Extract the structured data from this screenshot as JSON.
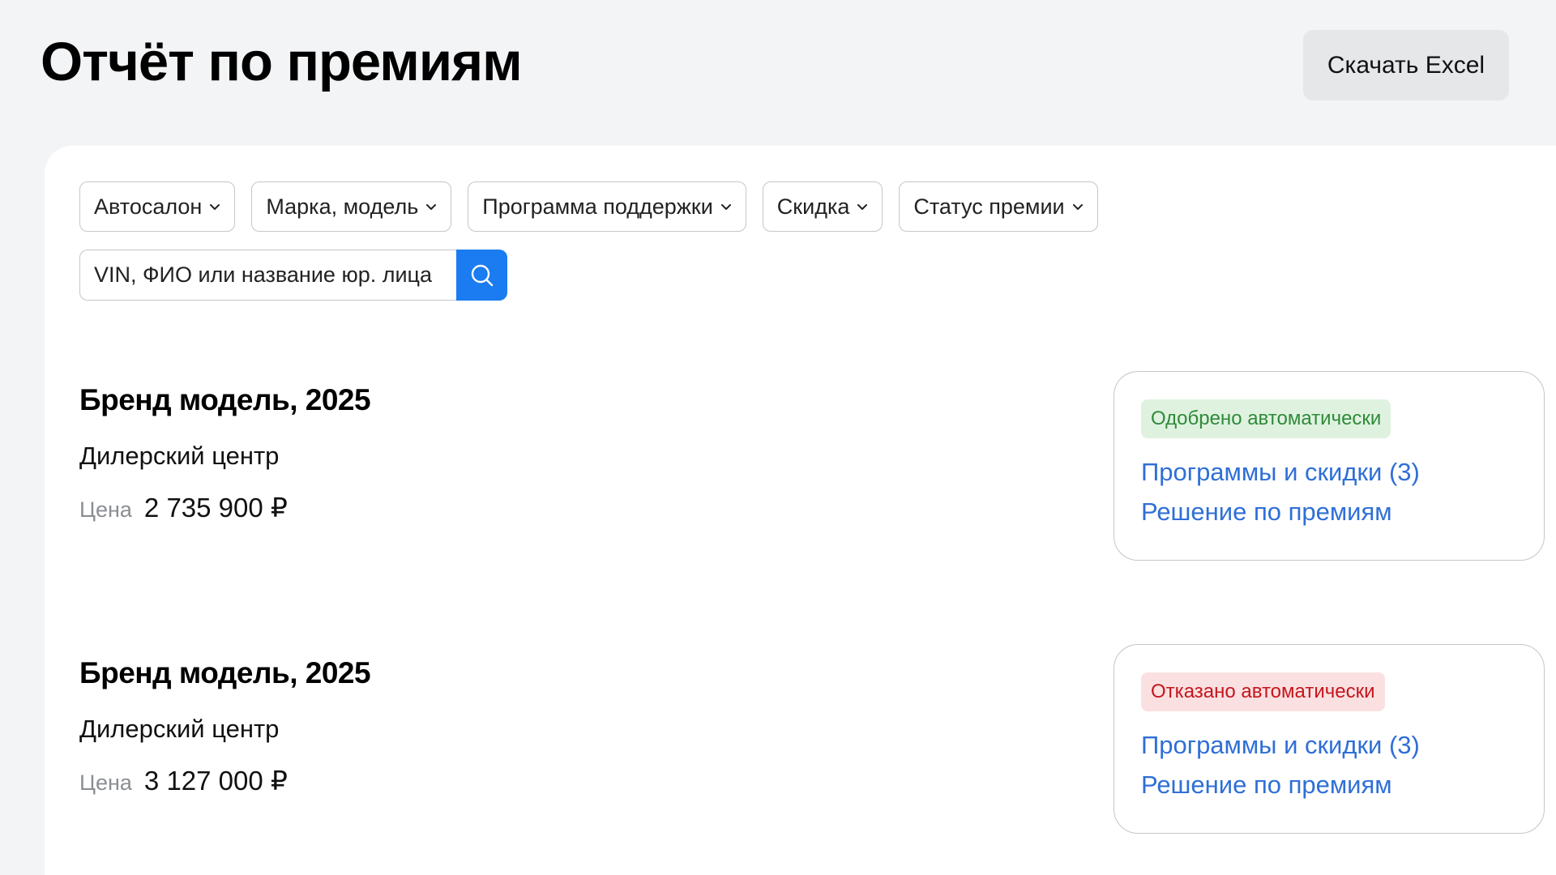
{
  "header": {
    "title": "Отчёт по  премиям",
    "download_label": "Скачать Excel"
  },
  "filters": [
    {
      "label": "Автосалон"
    },
    {
      "label": "Марка, модель"
    },
    {
      "label": "Программа поддержки"
    },
    {
      "label": "Скидка"
    },
    {
      "label": "Статус премии"
    }
  ],
  "search": {
    "placeholder": "VIN, ФИО или название юр. лица",
    "icon": "search-icon"
  },
  "records": [
    {
      "title": "Бренд модель, 2025",
      "dealer": "Дилерский центр",
      "price_label": "Цена",
      "price": "2 735 900 ₽",
      "status": "Одобрено автоматически",
      "status_type": "approved",
      "programs_link": "Программы и скидки (3)",
      "decision_link": "Решение по премиям"
    },
    {
      "title": "Бренд модель, 2025",
      "dealer": "Дилерский центр",
      "price_label": "Цена",
      "price": "3 127 000 ₽",
      "status": "Отказано автоматически",
      "status_type": "rejected",
      "programs_link": "Программы и скидки (3)",
      "decision_link": "Решение по премиям"
    }
  ],
  "colors": {
    "accent": "#1a7cf0",
    "link": "#2f6fd6",
    "approved_bg": "#dff2df",
    "approved_text": "#2f8a3a",
    "rejected_bg": "#fbe0e1",
    "rejected_text": "#c4161c",
    "page_bg": "#f3f4f6"
  }
}
